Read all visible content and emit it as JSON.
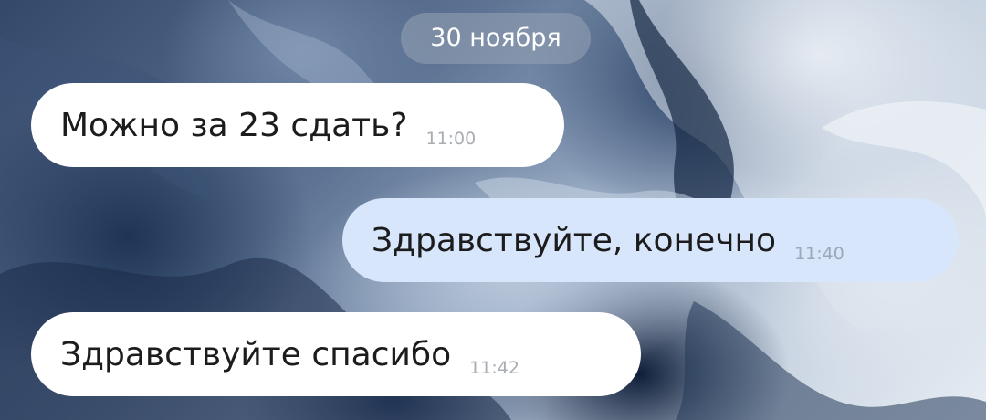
{
  "chat": {
    "date_separator": "30 ноября",
    "messages": [
      {
        "direction": "incoming",
        "text": "Можно за 23 сдать?",
        "time": "11:00"
      },
      {
        "direction": "outgoing",
        "text": "Здравствуйте, конечно",
        "time": "11:40"
      },
      {
        "direction": "incoming",
        "text": "Здравствуйте спасибо",
        "time": "11:42"
      }
    ]
  },
  "colors": {
    "incoming_bubble": "#ffffff",
    "outgoing_bubble": "#d7e6fb",
    "date_pill": "#96a2b4",
    "time_text": "#a8acb3"
  }
}
